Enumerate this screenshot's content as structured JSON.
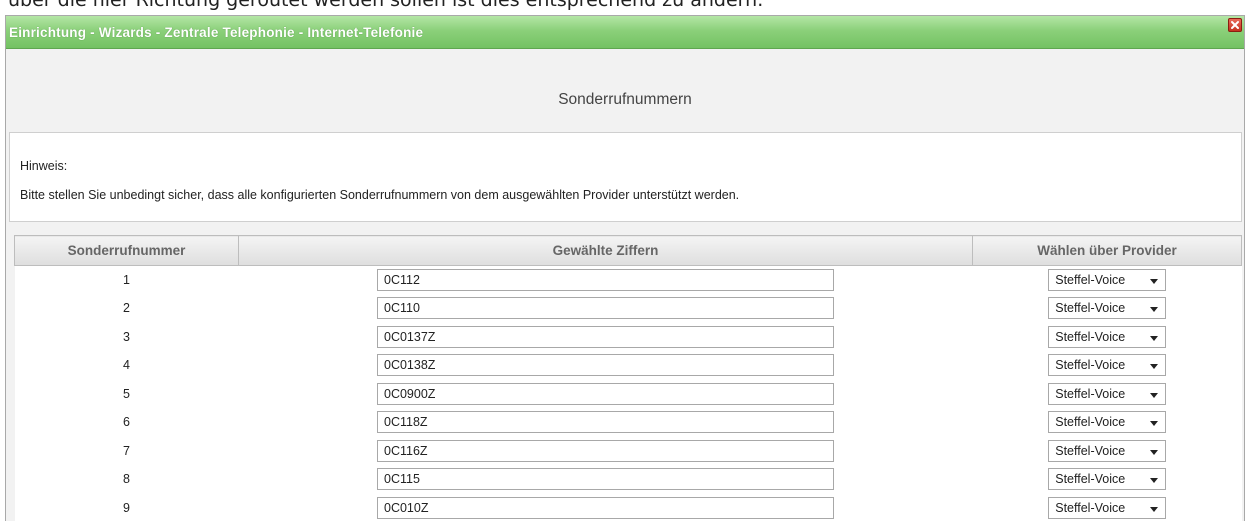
{
  "document": {
    "partial_line": "über die hier Richtung geroutet werden sollen ist dies entsprechend zu ändern."
  },
  "window": {
    "title": "Einrichtung - Wizards - Zentrale Telephonie - Internet-Telefonie",
    "close_icon": "close-icon",
    "accent_color": "#7ec86c"
  },
  "page": {
    "heading": "Sonderrufnummern"
  },
  "hint": {
    "label": "Hinweis:",
    "text": "Bitte stellen Sie unbedingt sicher, dass alle konfigurierten Sonderrufnummern von dem ausgewählten Provider unterstützt werden."
  },
  "table": {
    "headers": [
      "Sonderrufnummer",
      "Gewählte Ziffern",
      "Wählen über Provider"
    ],
    "rows": [
      {
        "number": "1",
        "digits": "0C112",
        "provider": "Steffel-Voice"
      },
      {
        "number": "2",
        "digits": "0C110",
        "provider": "Steffel-Voice"
      },
      {
        "number": "3",
        "digits": "0C0137Z",
        "provider": "Steffel-Voice"
      },
      {
        "number": "4",
        "digits": "0C0138Z",
        "provider": "Steffel-Voice"
      },
      {
        "number": "5",
        "digits": "0C0900Z",
        "provider": "Steffel-Voice"
      },
      {
        "number": "6",
        "digits": "0C118Z",
        "provider": "Steffel-Voice"
      },
      {
        "number": "7",
        "digits": "0C116Z",
        "provider": "Steffel-Voice"
      },
      {
        "number": "8",
        "digits": "0C115",
        "provider": "Steffel-Voice"
      },
      {
        "number": "9",
        "digits": "0C010Z",
        "provider": "Steffel-Voice"
      }
    ]
  }
}
